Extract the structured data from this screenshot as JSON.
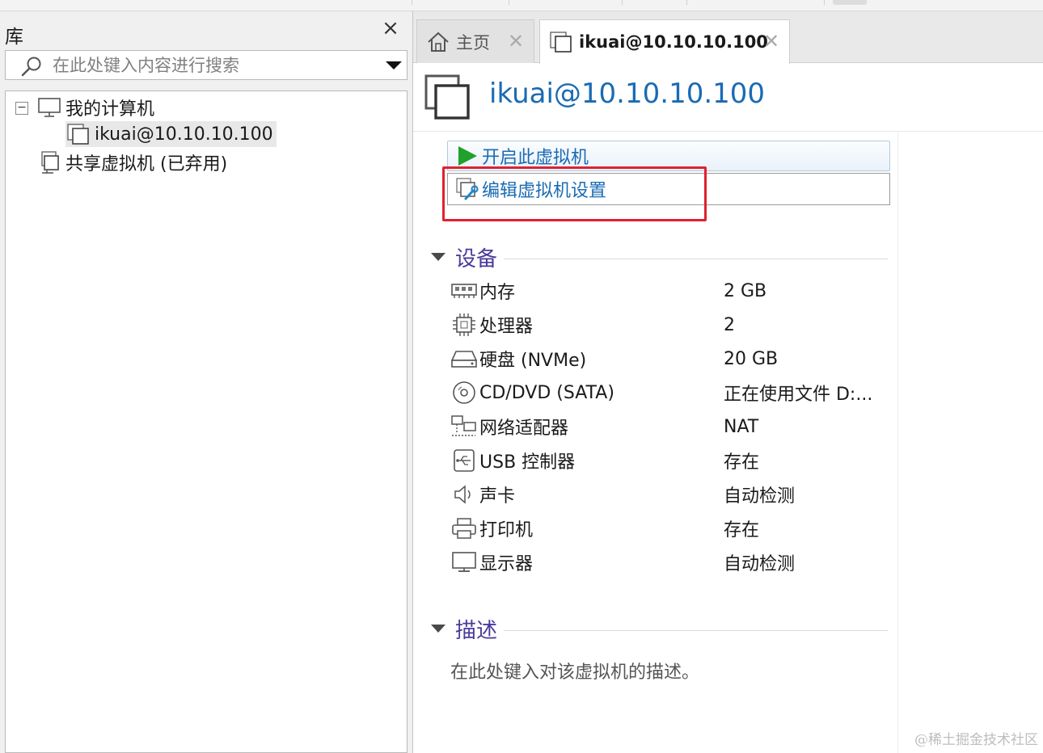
{
  "library": {
    "title": "库",
    "search": {
      "placeholder": "在此处键入内容进行搜索"
    },
    "tree": {
      "my_computer": "我的计算机",
      "vm": "ikuai@10.10.10.100",
      "shared": "共享虚拟机 (已弃用)",
      "expander": "−"
    }
  },
  "tabs": [
    {
      "label": "主页",
      "icon": "home-icon"
    },
    {
      "label": "ikuai@10.10.10.100",
      "icon": "vm-icon",
      "active": true
    }
  ],
  "vm": {
    "title": "ikuai@10.10.10.100",
    "commands": {
      "power_on": "开启此虚拟机",
      "edit_settings": "编辑虚拟机设置"
    }
  },
  "devices": {
    "title": "设备",
    "rows": [
      {
        "icon": "memory-icon",
        "name": "内存",
        "value": "2 GB"
      },
      {
        "icon": "cpu-icon",
        "name": "处理器",
        "value": "2"
      },
      {
        "icon": "hdd-icon",
        "name": "硬盘 (NVMe)",
        "value": "20 GB"
      },
      {
        "icon": "cd-icon",
        "name": "CD/DVD (SATA)",
        "value": "正在使用文件 D:..."
      },
      {
        "icon": "network-icon",
        "name": "网络适配器",
        "value": "NAT"
      },
      {
        "icon": "usb-icon",
        "name": "USB 控制器",
        "value": "存在"
      },
      {
        "icon": "sound-icon",
        "name": "声卡",
        "value": "自动检测"
      },
      {
        "icon": "printer-icon",
        "name": "打印机",
        "value": "存在"
      },
      {
        "icon": "display-icon",
        "name": "显示器",
        "value": "自动检测"
      }
    ]
  },
  "description": {
    "title": "描述",
    "placeholder": "在此处键入对该虚拟机的描述。"
  },
  "watermark": "@稀土掘金技术社区",
  "colors": {
    "accent_blue": "#1a6bb3",
    "section_purple": "#4b3a9a",
    "highlight_red": "#e0212f",
    "play_green": "#1fa12b"
  }
}
